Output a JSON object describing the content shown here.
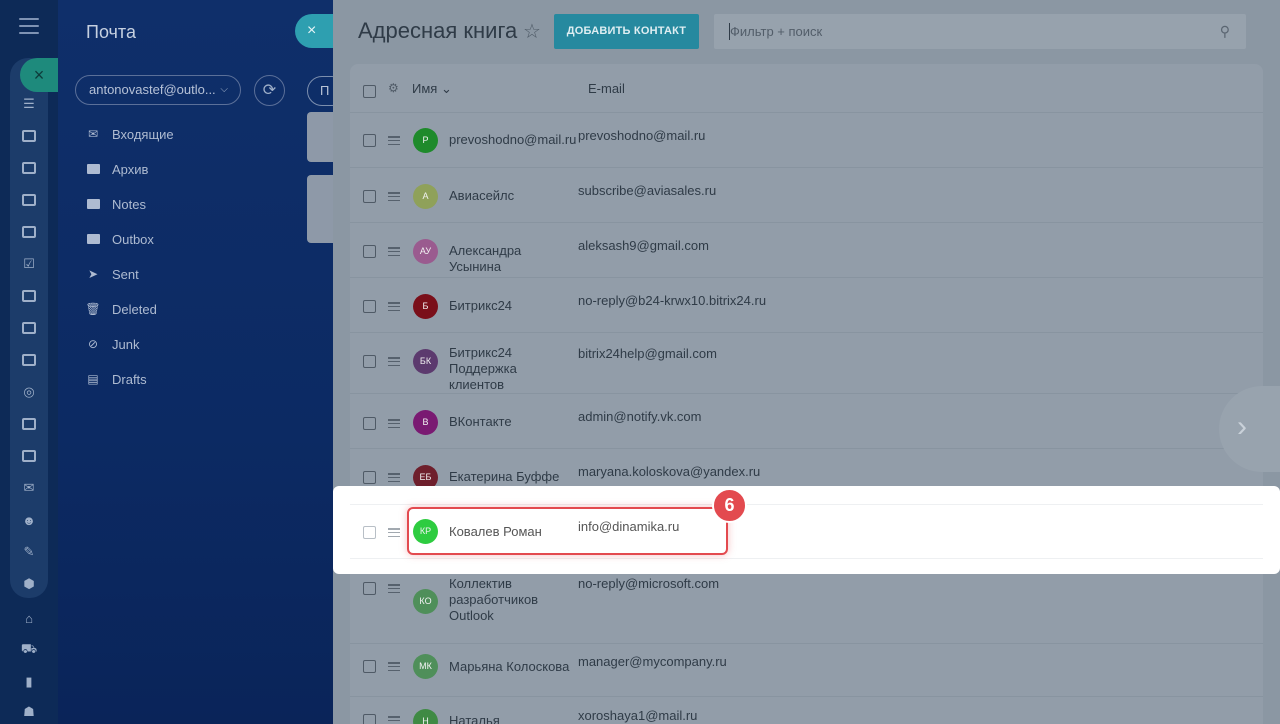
{
  "mail": {
    "title": "Почта",
    "account": "antonovastef@outlo...",
    "folders": [
      {
        "label": "Входящие",
        "icon": "inbox-icon"
      },
      {
        "label": "Архив",
        "icon": "folder-icon"
      },
      {
        "label": "Notes",
        "icon": "folder-icon"
      },
      {
        "label": "Outbox",
        "icon": "folder-icon"
      },
      {
        "label": "Sent",
        "icon": "sent-icon"
      },
      {
        "label": "Deleted",
        "icon": "trash-icon"
      },
      {
        "label": "Junk",
        "icon": "junk-icon"
      },
      {
        "label": "Drafts",
        "icon": "draft-icon"
      }
    ]
  },
  "middle": {
    "close_glyph": "×",
    "button_label": "П"
  },
  "address_book": {
    "title": "Адресная книга",
    "add_button": "ДОБАВИТЬ КОНТАКТ",
    "search_placeholder": "Фильтр + поиск",
    "columns": {
      "name": "Имя",
      "email": "E-mail"
    },
    "rows": [
      {
        "initials": "P",
        "name": "prevoshodno@mail.ru",
        "email": "prevoshodno@mail.ru",
        "color": "#1e8a2b"
      },
      {
        "initials": "A",
        "name": "Авиасейлс",
        "email": "subscribe@aviasales.ru",
        "color": "#8fa15a"
      },
      {
        "initials": "АУ",
        "name": "Александра Усынина",
        "email": "aleksash9@gmail.com",
        "color": "#9a5b8f"
      },
      {
        "initials": "Б",
        "name": "Битрикс24",
        "email": "no-reply@b24-krwx10.bitrix24.ru",
        "color": "#7a0f1a"
      },
      {
        "initials": "БК",
        "name": "Битрикс24 Поддержка клиентов",
        "email": "bitrix24help@gmail.com",
        "color": "#5c3a6e"
      },
      {
        "initials": "B",
        "name": "ВКонтакте",
        "email": "admin@notify.vk.com",
        "color": "#7a1a72"
      },
      {
        "initials": "ЕБ",
        "name": "Екатерина Буффе",
        "email": "maryana.koloskova@yandex.ru",
        "color": "#6e1f2c"
      },
      {
        "initials": "КР",
        "name": "Ковалев Роман",
        "email": "info@dinamika.ru",
        "color": "#2ecc40"
      },
      {
        "initials": "КО",
        "name": "Коллектив разработчиков Outlook",
        "email": "no-reply@microsoft.com",
        "color": "#4f8f5a"
      },
      {
        "initials": "МК",
        "name": "Марьяна Колоскова",
        "email": "manager@mycompany.ru",
        "color": "#4f8f5a"
      },
      {
        "initials": "Н",
        "name": "Наталья",
        "email": "xoroshaya1@mail.ru",
        "color": "#3f8a44"
      }
    ]
  },
  "callout": {
    "step": "6"
  }
}
